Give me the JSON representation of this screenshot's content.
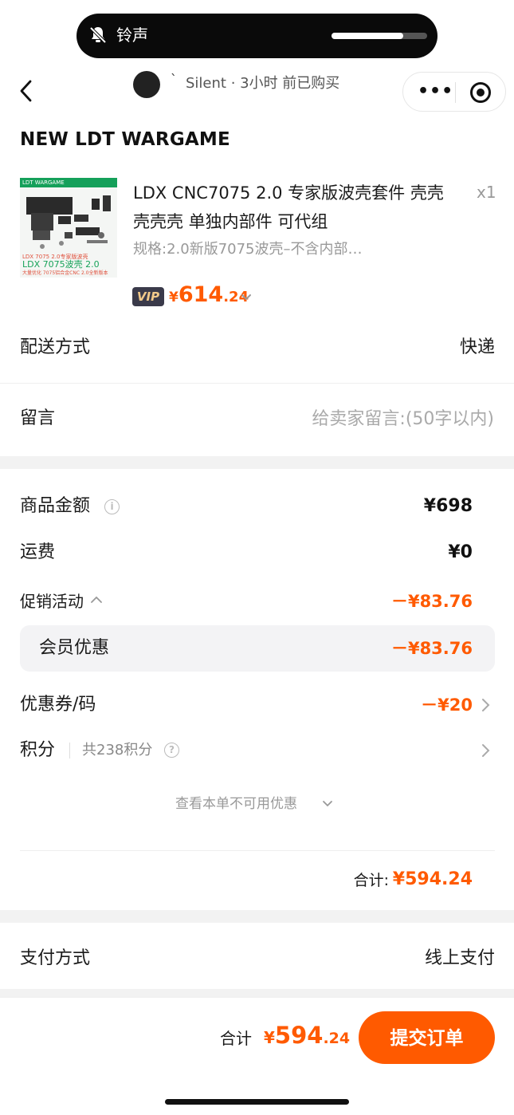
{
  "notification": {
    "text": "铃声",
    "volume_level": 0.75
  },
  "header": {
    "buyer_mark": "ˋ",
    "buyer_text": "Silent · 3小时 前已购买"
  },
  "shop": {
    "name": "NEW LDT WARGAME"
  },
  "product": {
    "title": "LDX CNC7075 2.0 专家版波壳套件 壳壳壳壳壳 单独内部件 可代组",
    "quantity": "x1",
    "spec": "规格:2.0新版7075波壳–不含内部…",
    "vip_label": "VIP",
    "price_currency": "¥",
    "price_int": "614",
    "price_dec": ".24",
    "thumb_band": "LDT WARGAME",
    "thumb_line1": "LDX 7075 2.0专家版波壳",
    "thumb_line2": "LDX 7075波壳 2.0",
    "thumb_line3": "大量优化 7075铝合金CNC 2.0全新版本"
  },
  "delivery": {
    "label": "配送方式",
    "value": "快递"
  },
  "message": {
    "label": "留言",
    "placeholder": "给卖家留言:(50字以内)"
  },
  "summary": {
    "goods_label": "商品金额",
    "goods_value": "¥698",
    "shipping_label": "运费",
    "shipping_value": "¥0",
    "promo_label": "促销活动",
    "promo_value": "－¥83.76",
    "member_label": "会员优惠",
    "member_value": "－¥83.76",
    "coupon_label": "优惠券/码",
    "coupon_value": "－¥20",
    "points_label": "积分",
    "points_info": "共238积分",
    "unavailable_link": "查看本单不可用优惠",
    "total_label": "合计:",
    "total_value": "¥594.24"
  },
  "payment": {
    "label": "支付方式",
    "value": "线上支付"
  },
  "footer": {
    "total_label": "合计",
    "total_currency": "¥",
    "total_int": "594",
    "total_dec": ".24",
    "submit_label": "提交订单"
  },
  "colors": {
    "accent": "#ff5a00",
    "divider": "#f2f2f2"
  },
  "icons": [
    "bell-mute-icon",
    "back-icon",
    "more-icon",
    "target-icon",
    "info-icon",
    "help-icon",
    "chevron-right-icon",
    "chevron-down-icon",
    "chevron-up-icon"
  ]
}
